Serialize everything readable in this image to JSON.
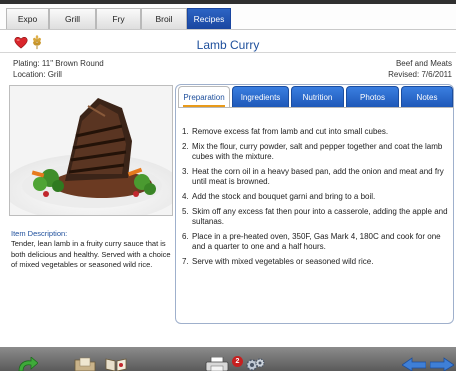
{
  "top_tabs": [
    "Expo",
    "Grill",
    "Fry",
    "Broil",
    "Recipes"
  ],
  "active_top_tab": "Recipes",
  "title": "Lamb Curry",
  "plating": "Plating: 11\" Brown Round",
  "location": "Location: Grill",
  "category": "Beef and Meats",
  "revised": "Revised: 7/6/2011",
  "item_description": {
    "label": "Item Description:",
    "text": "Tender, lean lamb in a fruity curry sauce that is both delicious and healthy. Served with a choice of mixed vegetables or seasoned wild rice."
  },
  "recipe_tabs": [
    "Preparation",
    "Ingredients",
    "Nutrition",
    "Photos",
    "Notes"
  ],
  "active_recipe_tab": "Preparation",
  "steps": [
    {
      "num": "1.",
      "text": "Remove excess fat from lamb and cut into small cubes."
    },
    {
      "num": "2.",
      "text": "Mix the flour, curry powder, salt and pepper together  and coat the lamb cubes with the mixture."
    },
    {
      "num": "3.",
      "text": "Heat the corn oil in a heavy based pan, add the onion and meat and fry until meat is browned."
    },
    {
      "num": "4.",
      "text": "Add the stock and bouquet garni and bring to a boil."
    },
    {
      "num": "5.",
      "text": "Skim off any excess fat then pour into a casserole, adding the apple and sultanas."
    },
    {
      "num": "6.",
      "text": "Place in a pre-heated oven, 350F, Gas Mark 4, 180C and cook for one and a quarter to one and a half hours."
    },
    {
      "num": "7.",
      "text": "Serve with mixed vegetables or seasoned wild rice."
    }
  ],
  "badge_count": "2",
  "colors": {
    "accent_blue": "#1e58b8",
    "title_blue": "#1e4f9c",
    "tab_highlight": "#e89a1a",
    "badge_red": "#c62020"
  },
  "icons": {
    "header": [
      "heart-icon",
      "wheat-icon"
    ],
    "toolbar": [
      "refresh-arrow-icon",
      "folder-icon",
      "book-icon",
      "printer-icon",
      "settings-icon",
      "back-arrow-icon",
      "forward-arrow-icon"
    ]
  }
}
